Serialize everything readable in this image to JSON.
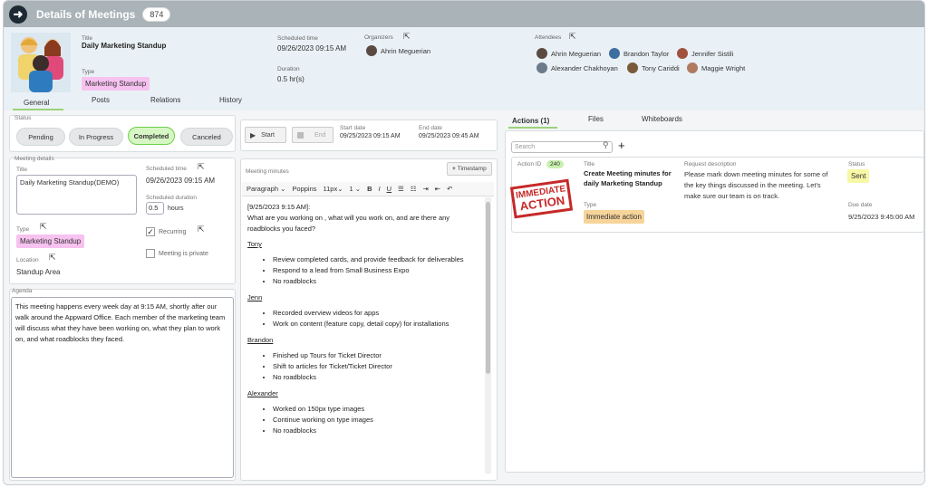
{
  "topbar": {
    "title": "Details of Meetings",
    "count": "874"
  },
  "meeting": {
    "title_label": "Title",
    "title": "Daily Marketing Standup",
    "type_label": "Type",
    "type": "Marketing Standup",
    "scheduled_label": "Scheduled time",
    "scheduled": "09/26/2023 09:15 AM",
    "duration_label": "Duration",
    "duration": "0.5 hr(s)",
    "organizers_label": "Organizers",
    "organizer": "Ahrin Meguerian",
    "attendees_label": "Attendees",
    "attendees": [
      "Ahrin Meguerian",
      "Brandon Taylor",
      "Jennifer Sistili",
      "Alexander Chakhoyan",
      "Tony Cariddi",
      "Maggie Wright"
    ]
  },
  "tabs": [
    "General",
    "Posts",
    "Relations",
    "History"
  ],
  "status": {
    "label": "Status",
    "options": [
      "Pending",
      "In Progress",
      "Completed",
      "Canceled"
    ],
    "selected": "Completed"
  },
  "details": {
    "label": "Meeting details",
    "title_label": "Title",
    "title_value": "Daily Marketing Standup(DEMO)",
    "sched_label": "Scheduled time",
    "sched_value": "09/26/2023 09:15 AM",
    "dur_label": "Scheduled duration",
    "dur_value": "0.5",
    "dur_unit": "hours",
    "recurring": "Recurring",
    "private": "Meeting is private",
    "type_label": "Type",
    "type_value": "Marketing Standup",
    "location_label": "Location",
    "location_value": "Standup Area"
  },
  "agenda": {
    "label": "Agenda",
    "text": "This meeting happens every week day at 9:15 AM, shortly after our walk around the Appward Office. Each member of the marketing team will discuss what they have been working on, what they plan to work on, and what roadblocks they faced."
  },
  "timing": {
    "start_btn": "Start",
    "end_btn": "End",
    "start_label": "Start date",
    "start_value": "09/25/2023 09:15 AM",
    "end_label": "End date",
    "end_value": "09/25/2023 09:45 AM"
  },
  "minutes": {
    "label": "Meeting minutes",
    "timestamp_btn": "Timestamp",
    "toolbar": {
      "format": "Paragraph",
      "font": "Poppins",
      "size": "11px",
      "line": "1"
    },
    "heading": "[9/25/2023 9:15 AM]:",
    "intro": "What are you working on , what will you work on, and are there any roadblocks you faced?",
    "people": [
      {
        "name": "Tony",
        "items": [
          "Review completed cards, and provide feedback for deliverables",
          "Respond to a lead from Small Business Expo",
          "No roadblocks"
        ]
      },
      {
        "name": "Jenn",
        "items": [
          "Recorded overview videos for apps",
          "Work on content (feature copy, detail copy) for installations"
        ]
      },
      {
        "name": "Brandon",
        "items": [
          "Finished up Tours for Ticket Director",
          "Shift to articles for Ticket/Ticket Director",
          "No roadblocks"
        ]
      },
      {
        "name": "Alexander",
        "items": [
          "Worked on 150px type images",
          "Continue working on type images",
          "No roadblocks"
        ]
      }
    ]
  },
  "right": {
    "tabs": [
      "Actions (1)",
      "Files",
      "Whiteboards"
    ],
    "search_placeholder": "Search",
    "action": {
      "id_label": "Action ID",
      "id": "240",
      "title_label": "Title",
      "title": "Create Meeting minutes for daily Marketing Standup",
      "type_label": "Type",
      "type": "Immediate action",
      "desc_label": "Request description",
      "desc": "Please mark down meeting minutes for some of the key things discussed in the meeting. Let's make sure our team is on track.",
      "status_label": "Status",
      "status": "Sent",
      "due_label": "Due date",
      "due": "9/25/2023 9:45:00 AM",
      "stamp_line1": "IMMEDIATE",
      "stamp_line2": "ACTION"
    }
  }
}
